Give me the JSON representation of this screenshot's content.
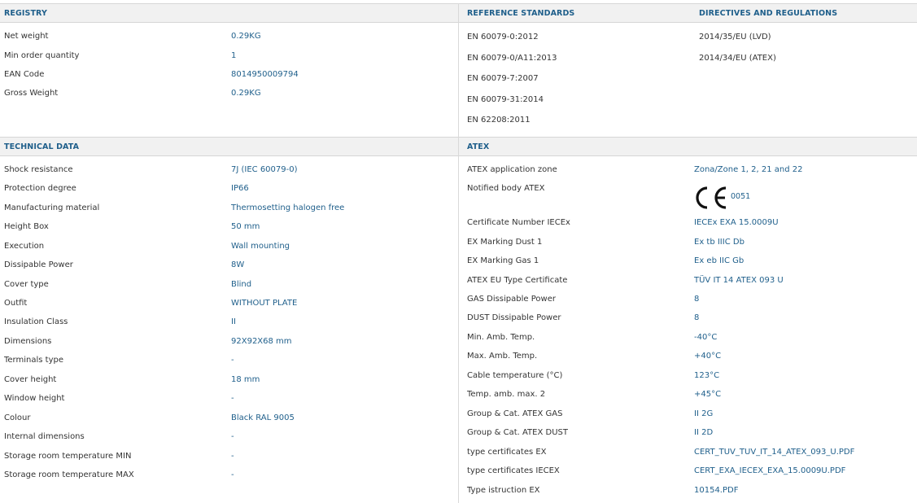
{
  "registry": {
    "header": "REGISTRY",
    "rows": [
      {
        "label": "Net weight",
        "value": "0.29KG"
      },
      {
        "label": "Min order quantity",
        "value": "1"
      },
      {
        "label": "EAN Code",
        "value": "8014950009794"
      },
      {
        "label": "Gross Weight",
        "value": "0.29KG"
      }
    ]
  },
  "reference_standards": {
    "header": "REFERENCE STANDARDS",
    "items": [
      "EN 60079-0:2012",
      "EN 60079-0/A11:2013",
      "EN 60079-7:2007",
      "EN 60079-31:2014",
      "EN 62208:2011"
    ]
  },
  "directives": {
    "header": "DIRECTIVES AND REGULATIONS",
    "items": [
      "2014/35/EU (LVD)",
      "2014/34/EU (ATEX)"
    ]
  },
  "technical_data": {
    "header": "TECHNICAL DATA",
    "rows": [
      {
        "label": "Shock resistance",
        "value": "7J (IEC 60079-0)"
      },
      {
        "label": "Protection degree",
        "value": "IP66"
      },
      {
        "label": "Manufacturing material",
        "value": "Thermosetting halogen free"
      },
      {
        "label": "Height Box",
        "value": "50 mm"
      },
      {
        "label": "Execution",
        "value": "Wall mounting"
      },
      {
        "label": "Dissipable Power",
        "value": "8W"
      },
      {
        "label": "Cover type",
        "value": "Blind"
      },
      {
        "label": "Outfit",
        "value": "WITHOUT PLATE"
      },
      {
        "label": "Insulation Class",
        "value": "II"
      },
      {
        "label": "Dimensions",
        "value": "92X92X68 mm"
      },
      {
        "label": "Terminals type",
        "value": "-"
      },
      {
        "label": "Cover height",
        "value": "18 mm"
      },
      {
        "label": "Window height",
        "value": "-"
      },
      {
        "label": "Colour",
        "value": "Black RAL 9005"
      },
      {
        "label": "Internal dimensions",
        "value": "-"
      },
      {
        "label": "Storage room temperature MIN",
        "value": "-"
      },
      {
        "label": "Storage room temperature MAX",
        "value": "-"
      }
    ]
  },
  "atex": {
    "header": "ATEX",
    "application_zone": {
      "label": "ATEX application zone",
      "value": "Zona/Zone 1, 2, 21 and 22"
    },
    "notified_body": {
      "label": "Notified body ATEX",
      "ce_text": "CE",
      "number": "0051"
    },
    "rows": [
      {
        "label": "Certificate Number IECEx",
        "value": "IECEx EXA 15.0009U"
      },
      {
        "label": "EX Marking Dust 1",
        "value": "Ex tb IIIC Db"
      },
      {
        "label": "EX Marking Gas 1",
        "value": "Ex eb IIC Gb"
      },
      {
        "label": "ATEX EU Type Certificate",
        "value": "TÜV IT 14 ATEX 093 U"
      },
      {
        "label": "GAS Dissipable Power",
        "value": "8"
      },
      {
        "label": "DUST Dissipable Power",
        "value": "8"
      },
      {
        "label": "Min. Amb. Temp.",
        "value": "-40°C"
      },
      {
        "label": "Max. Amb. Temp.",
        "value": "+40°C"
      },
      {
        "label": "Cable temperature (°C)",
        "value": "123°C"
      },
      {
        "label": "Temp. amb. max. 2",
        "value": "+45°C"
      },
      {
        "label": "Group & Cat. ATEX GAS",
        "value": "II 2G"
      },
      {
        "label": "Group & Cat. ATEX DUST",
        "value": "II 2D"
      },
      {
        "label": "type certificates EX",
        "value": "CERT_TUV_TUV_IT_14_ATEX_093_U.PDF"
      },
      {
        "label": "type certificates IECEX",
        "value": "CERT_EXA_IECEX_EXA_15.0009U.PDF"
      },
      {
        "label": "Type istruction EX",
        "value": "10154.PDF"
      }
    ]
  }
}
